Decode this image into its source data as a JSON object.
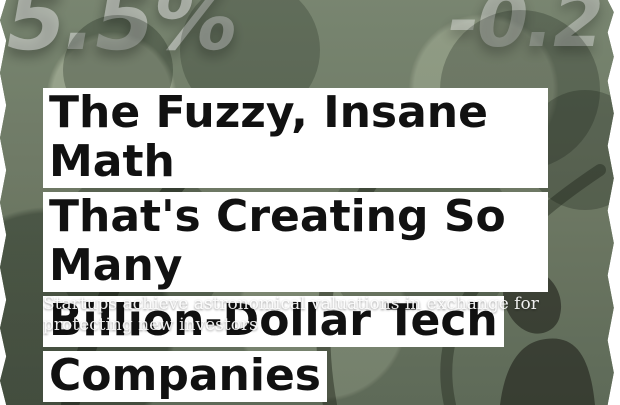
{
  "background": {
    "ticker_left": "5.5%",
    "ticker_right": "-0.2"
  },
  "article": {
    "headline_lines": [
      "The Fuzzy, Insane Math",
      "That's Creating So Many",
      "Billion-Dollar Tech",
      "Companies"
    ],
    "subheadline": "Startups achieve astronomical valuations in exchange for protecting new investors"
  }
}
